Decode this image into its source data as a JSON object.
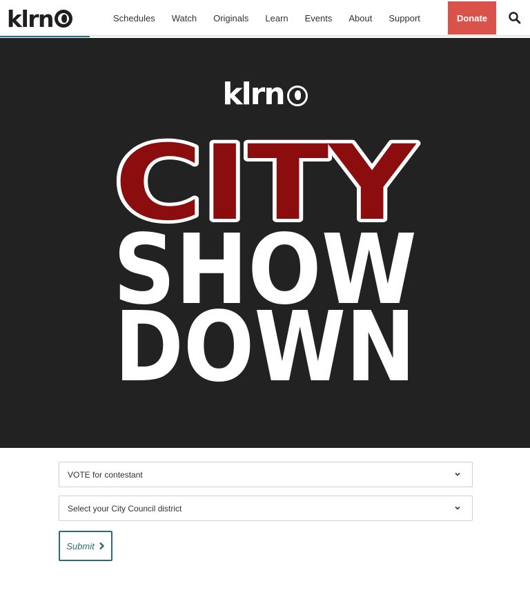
{
  "header": {
    "logo_text": "klrn",
    "nav": [
      "Schedules",
      "Watch",
      "Originals",
      "Learn",
      "Events",
      "About",
      "Support"
    ],
    "donate_label": "Donate"
  },
  "hero": {
    "logo_text": "klrn",
    "title_line1": "CITY",
    "title_line2": "SHOW",
    "title_line3": "DOWN",
    "background": "#222222",
    "accent_red": "#8b0d0d"
  },
  "form": {
    "vote_select": "VOTE for contestant",
    "district_select": "Select your City Council district",
    "submit_label": "Submit"
  },
  "colors": {
    "donate": "#d9534a",
    "teal": "#2b6b79"
  }
}
